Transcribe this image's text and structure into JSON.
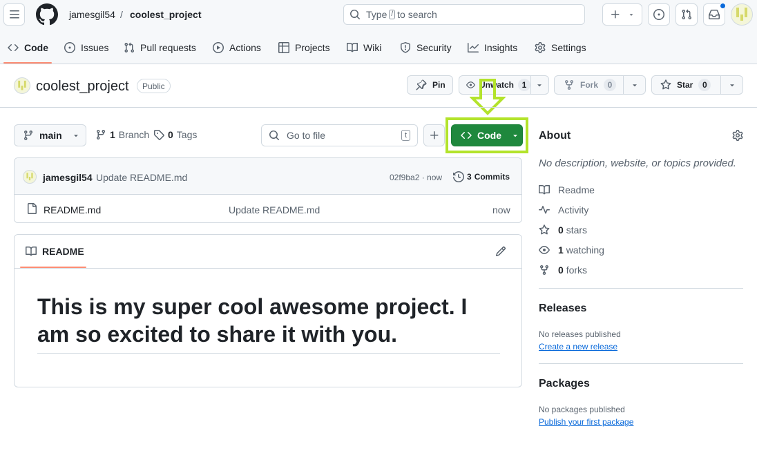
{
  "header": {
    "owner": "jamesgil54",
    "separator": "/",
    "repo": "coolest_project",
    "search_prefix": "Type",
    "search_key": "/",
    "search_suffix": "to search"
  },
  "tabs": [
    {
      "label": "Code",
      "icon": "code-icon"
    },
    {
      "label": "Issues",
      "icon": "issue-opened-icon"
    },
    {
      "label": "Pull requests",
      "icon": "git-pull-request-icon"
    },
    {
      "label": "Actions",
      "icon": "play-icon"
    },
    {
      "label": "Projects",
      "icon": "table-icon"
    },
    {
      "label": "Wiki",
      "icon": "book-icon"
    },
    {
      "label": "Security",
      "icon": "shield-icon"
    },
    {
      "label": "Insights",
      "icon": "graph-icon"
    },
    {
      "label": "Settings",
      "icon": "gear-icon"
    }
  ],
  "repo_header": {
    "name": "coolest_project",
    "visibility": "Public",
    "pin_label": "Pin",
    "unwatch_label": "Unwatch",
    "watch_count": "1",
    "fork_label": "Fork",
    "fork_count": "0",
    "star_label": "Star",
    "star_count": "0"
  },
  "file_nav": {
    "branch": "main",
    "branch_count": "1",
    "branch_label": "Branch",
    "tag_count": "0",
    "tag_label": "Tags",
    "goto_placeholder": "Go to file",
    "goto_key": "t",
    "code_label": "Code"
  },
  "latest_commit": {
    "author": "jamesgil54",
    "message": "Update README.md",
    "sha_time": "02f9ba2 · now",
    "commits_count": "3",
    "commits_label": "Commits"
  },
  "files": [
    {
      "name": "README.md",
      "message": "Update README.md",
      "time": "now"
    }
  ],
  "readme": {
    "tab_label": "README",
    "heading": "This is my super cool awesome project. I am so excited to share it with you."
  },
  "sidebar": {
    "about_title": "About",
    "about_desc": "No description, website, or topics provided.",
    "readme_label": "Readme",
    "activity_label": "Activity",
    "stars_count": "0",
    "stars_label": "stars",
    "watching_count": "1",
    "watching_label": "watching",
    "forks_count": "0",
    "forks_label": "forks",
    "releases_title": "Releases",
    "releases_empty": "No releases published",
    "releases_link": "Create a new release",
    "packages_title": "Packages",
    "packages_empty": "No packages published",
    "packages_link": "Publish your first package"
  },
  "colors": {
    "primary_green": "#1f883d",
    "highlight": "#b3e32b",
    "link": "#0969da",
    "notification_dot": "#0969da",
    "tab_underline": "#fd8c73"
  }
}
